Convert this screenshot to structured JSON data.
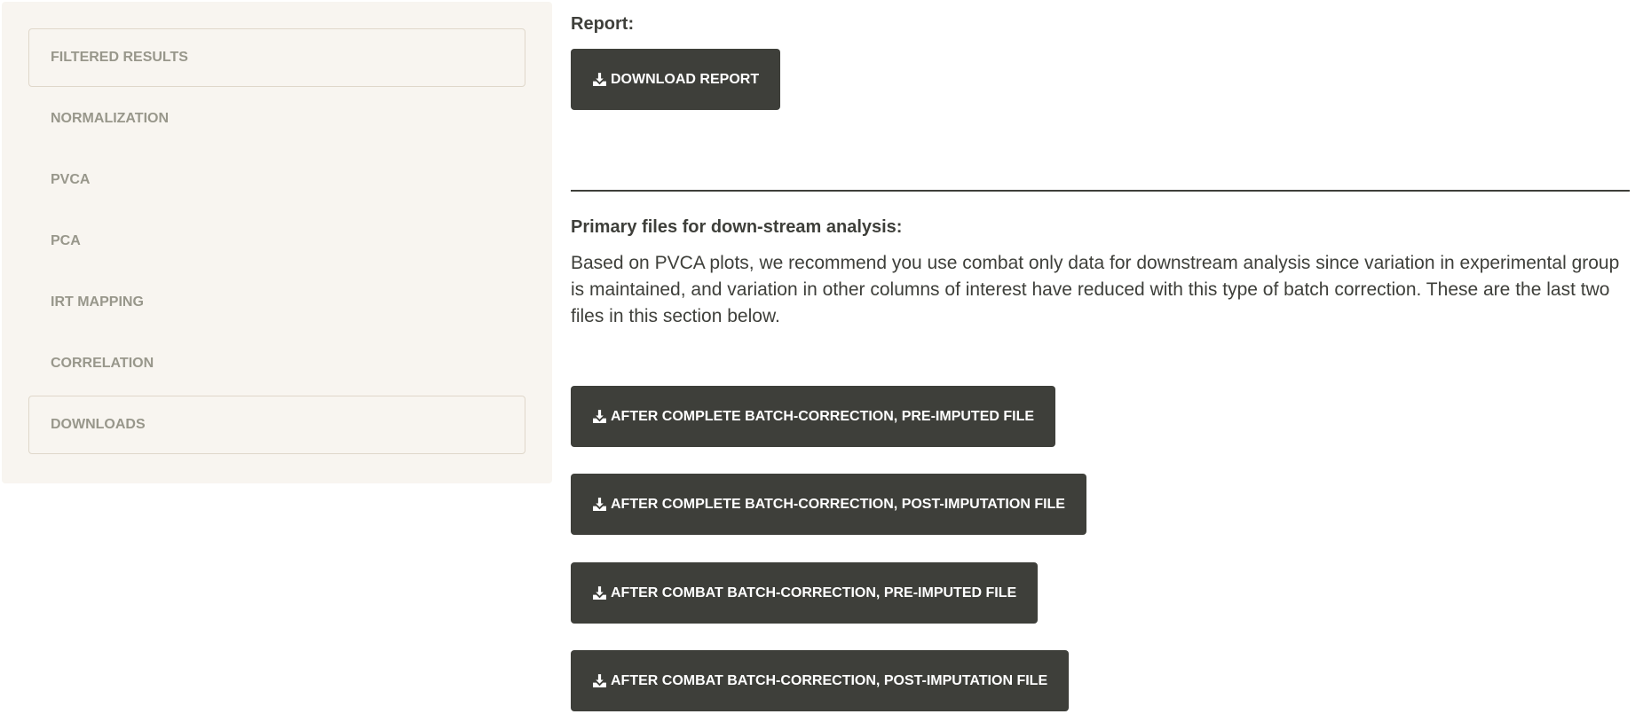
{
  "sidebar": {
    "items": [
      {
        "label": "FILTERED RESULTS"
      },
      {
        "label": "NORMALIZATION"
      },
      {
        "label": "PVCA"
      },
      {
        "label": "PCA"
      },
      {
        "label": "IRT MAPPING"
      },
      {
        "label": "CORRELATION"
      },
      {
        "label": "DOWNLOADS"
      }
    ]
  },
  "report": {
    "heading": "Report:",
    "button_label": "DOWNLOAD REPORT",
    "button_icon": "download-icon"
  },
  "primary": {
    "heading": "Primary files for down-stream analysis:",
    "description": "Based on PVCA plots, we recommend you use combat only data for downstream analysis since variation in experimental group is maintained, and variation in other columns of interest have reduced with this type of batch correction. These are the last two files in this section below.",
    "buttons": [
      {
        "label": "AFTER COMPLETE BATCH-CORRECTION, PRE-IMPUTED FILE"
      },
      {
        "label": "AFTER COMPLETE BATCH-CORRECTION, POST-IMPUTATION FILE"
      },
      {
        "label": "AFTER COMBAT BATCH-CORRECTION, PRE-IMPUTED FILE"
      },
      {
        "label": "AFTER COMBAT BATCH-CORRECTION, POST-IMPUTATION FILE"
      }
    ]
  },
  "colors": {
    "sidebar_bg": "#f8f5f0",
    "nav_text": "#98978b",
    "button_bg": "#3e3f3a",
    "button_text": "#ffffff",
    "body_text": "#3e3f3a"
  }
}
